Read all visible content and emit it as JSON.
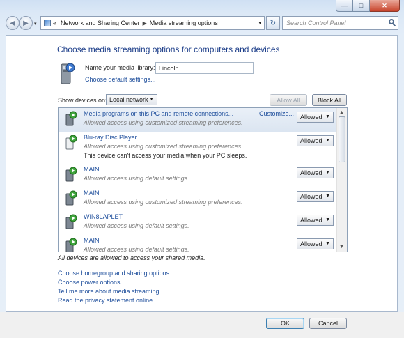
{
  "window": {
    "caption_buttons": {
      "minimize": "—",
      "maximize": "□",
      "close": "✕"
    }
  },
  "navbar": {
    "back_glyph": "◀",
    "forward_glyph": "▶",
    "history_glyph": "▾",
    "breadcrumb_lead": "«",
    "breadcrumb": [
      "Network and Sharing Center",
      "Media streaming options"
    ],
    "breadcrumb_sep": "▶",
    "dropdown_glyph": "▾",
    "refresh_glyph": "↻",
    "search_placeholder": "Search Control Panel"
  },
  "page": {
    "title": "Choose media streaming options for computers and devices",
    "library_label": "Name your media library:",
    "library_name": "Lincoln",
    "default_settings_link": "Choose default settings...",
    "show_devices_label": "Show devices on:",
    "show_devices_value": "Local network",
    "allow_all": "Allow All",
    "block_all": "Block All"
  },
  "devices": [
    {
      "name": "Media programs on this PC and remote connections...",
      "status": "Allowed access using customized streaming preferences.",
      "note": "",
      "customize": "Customize...",
      "access": "Allowed",
      "selected": true
    },
    {
      "name": "Blu-ray Disc Player",
      "status": "Allowed access using customized streaming preferences.",
      "note": "This device can't access your media when your PC sleeps.",
      "customize": "",
      "access": "Allowed",
      "selected": false
    },
    {
      "name": "MAIN",
      "status": "Allowed access using default settings.",
      "note": "",
      "customize": "",
      "access": "Allowed",
      "selected": false
    },
    {
      "name": "MAIN",
      "status": "Allowed access using customized streaming preferences.",
      "note": "",
      "customize": "",
      "access": "Allowed",
      "selected": false
    },
    {
      "name": "WIN8LAPLET",
      "status": "Allowed access using default settings.",
      "note": "",
      "customize": "",
      "access": "Allowed",
      "selected": false
    },
    {
      "name": "MAIN",
      "status": "Allowed access using default settings.",
      "note": "",
      "customize": "",
      "access": "Allowed",
      "selected": false
    }
  ],
  "summary": "All devices are allowed to access your shared media.",
  "links": [
    "Choose homegroup and sharing options",
    "Choose power options",
    "Tell me more about media streaming",
    "Read the privacy statement online"
  ],
  "footer": {
    "ok": "OK",
    "cancel": "Cancel"
  },
  "colors": {
    "link": "#1f4f9c",
    "title": "#1e3f8a",
    "status": "#7a7a7a",
    "selected_row": "#dbe5f1"
  }
}
